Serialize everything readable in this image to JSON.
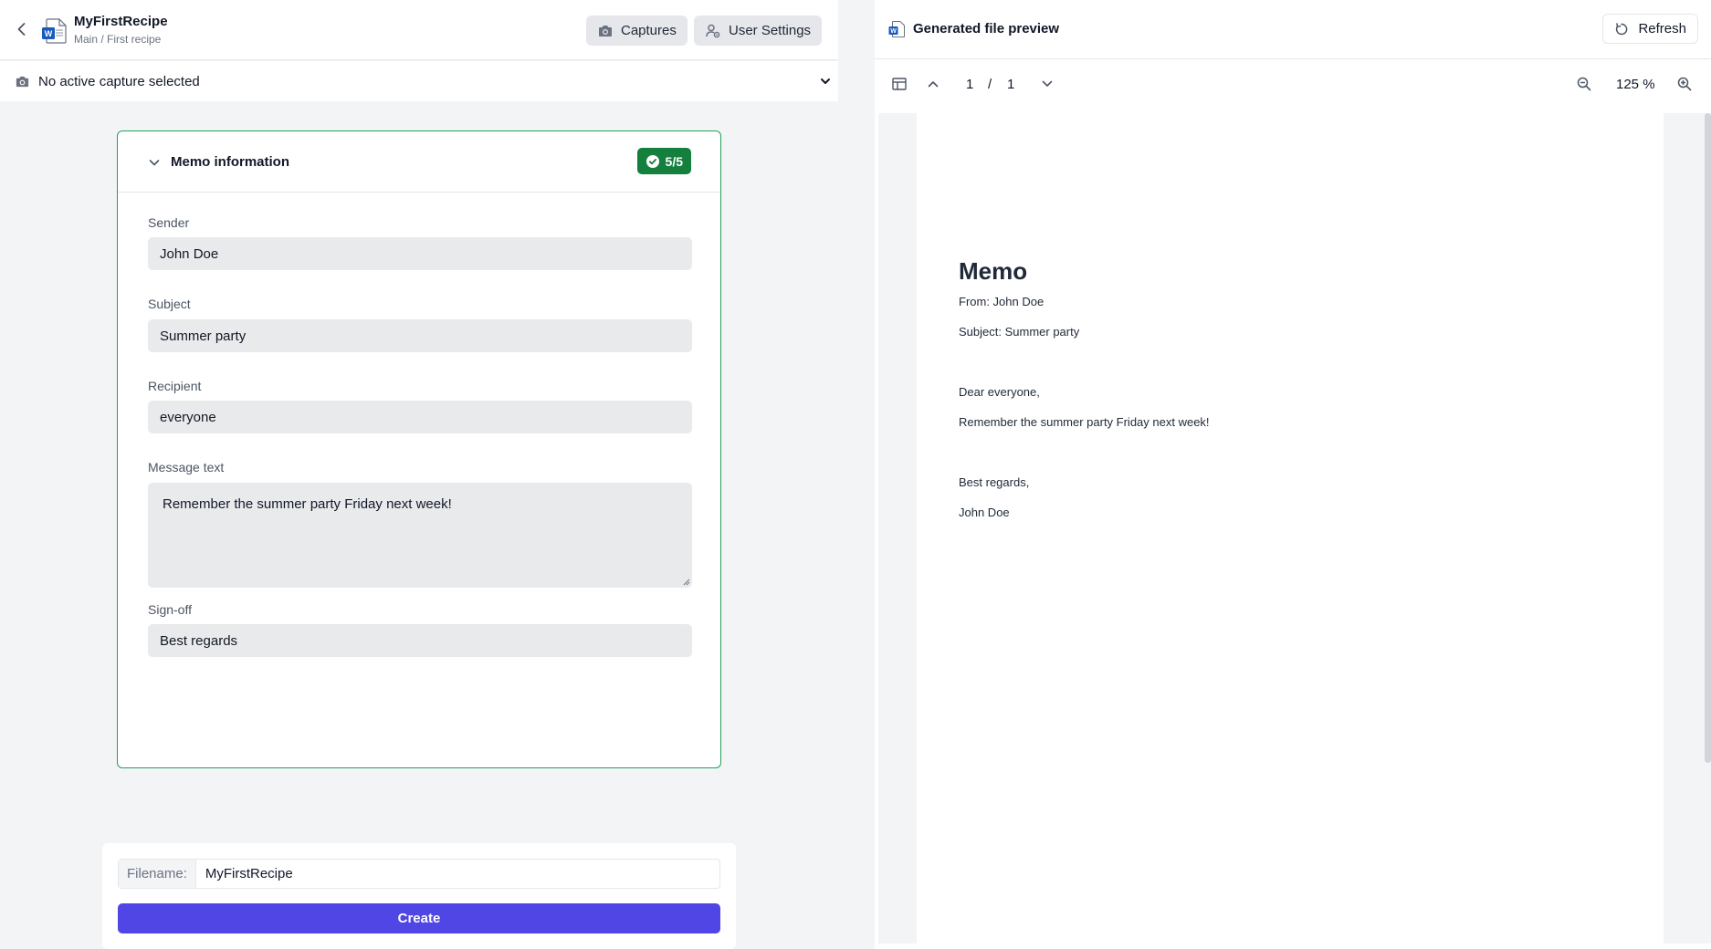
{
  "header": {
    "app_title": "MyFirstRecipe",
    "breadcrumb": "Main / First recipe",
    "captures_label": "Captures",
    "user_settings_label": "User Settings"
  },
  "capture_selector": {
    "text": "No active capture selected"
  },
  "memo_section": {
    "title": "Memo information",
    "badge": "5/5",
    "fields": {
      "sender": {
        "label": "Sender",
        "value": "John Doe"
      },
      "subject": {
        "label": "Subject",
        "value": "Summer party"
      },
      "recipient": {
        "label": "Recipient",
        "value": "everyone"
      },
      "message": {
        "label": "Message text",
        "value": "Remember the summer party Friday next week!"
      },
      "signoff": {
        "label": "Sign-off",
        "value": "Best regards"
      }
    }
  },
  "footer": {
    "filename_label": "Filename:",
    "filename_value": "MyFirstRecipe",
    "create_label": "Create"
  },
  "preview": {
    "title": "Generated file preview",
    "refresh_label": "Refresh",
    "page_current": "1",
    "page_sep": "/",
    "page_total": "1",
    "zoom": "125 %"
  },
  "document": {
    "heading": "Memo",
    "from_line": "From: John Doe",
    "subject_line": "Subject: Summer party",
    "greeting": "Dear everyone,",
    "body": "Remember the summer party Friday next week!",
    "closing": "Best regards,",
    "signature": "John Doe"
  },
  "colors": {
    "accent": "#4f46e5",
    "success": "#15803d",
    "card_border": "#22a05b"
  }
}
